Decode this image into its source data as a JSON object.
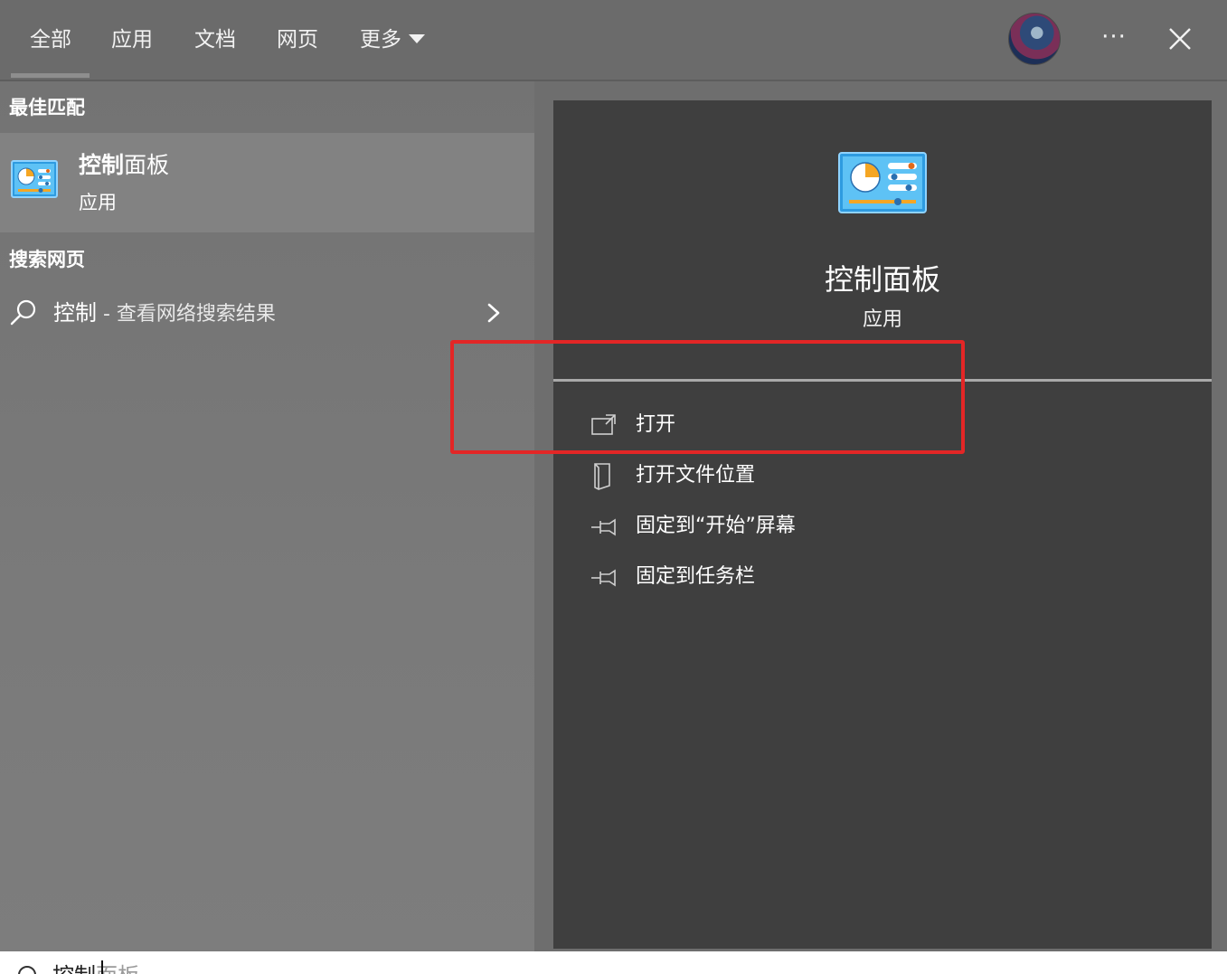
{
  "tabs": [
    {
      "label": "全部",
      "selected": true
    },
    {
      "label": "应用"
    },
    {
      "label": "文档"
    },
    {
      "label": "网页"
    },
    {
      "label": "更多"
    }
  ],
  "header": {
    "more_menu_icon": "ellipsis-icon",
    "close_icon": "close-icon",
    "avatar_icon": "user-avatar"
  },
  "results": {
    "best_match_heading": "最佳匹配",
    "best_match": {
      "title_highlight": "控制",
      "title_rest": "面板",
      "type": "应用",
      "icon": "control-panel-icon"
    },
    "web_heading": "搜索网页",
    "web_item": {
      "query": "控制",
      "suffix": " - 查看网络搜索结果",
      "icon": "search-icon"
    }
  },
  "preview": {
    "title": "控制面板",
    "subtitle": "应用",
    "icon": "control-panel-icon",
    "actions": [
      {
        "label": "打开",
        "icon": "open-window-icon"
      },
      {
        "label": "打开文件位置",
        "icon": "file-location-icon"
      },
      {
        "label": "固定到“开始”屏幕",
        "icon": "pin-icon"
      },
      {
        "label": "固定到任务栏",
        "icon": "pin-icon"
      }
    ]
  },
  "search": {
    "typed": "控制",
    "suggestion": "面板"
  },
  "colors": {
    "highlight": "#e32626",
    "preview_bg": "#3f3f3f",
    "left_bg": "#777777"
  }
}
